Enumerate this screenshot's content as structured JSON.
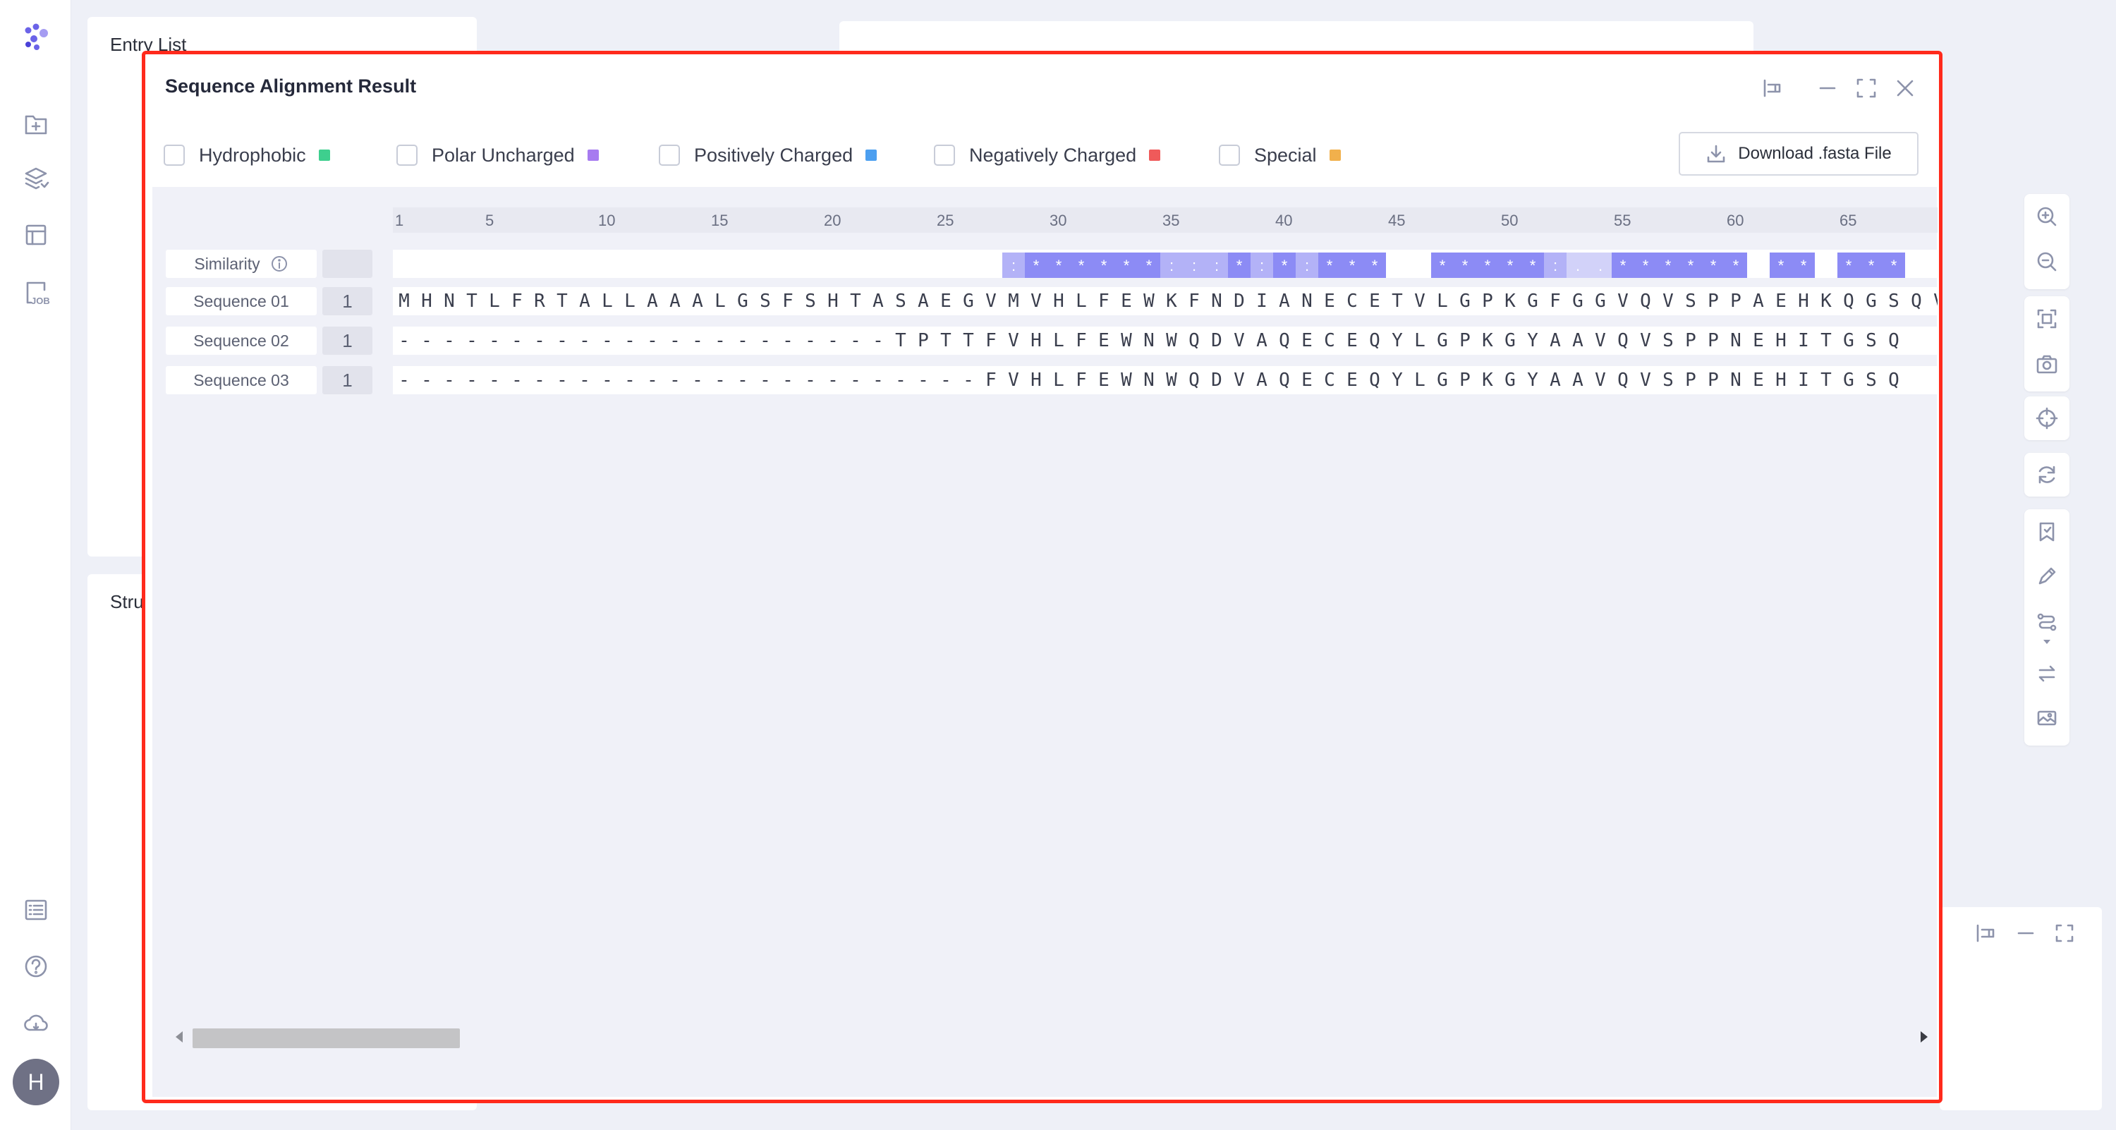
{
  "background": {
    "entry_list_title": "Entry List",
    "structure_title": "Stru"
  },
  "sidebar": {
    "logo": "app-logo",
    "items": [
      "add-file-icon",
      "layers-icon",
      "table-icon",
      "job-icon"
    ],
    "bottom_items": [
      "list-icon",
      "help-icon",
      "cloud-icon"
    ],
    "job_icon_text": "JOB",
    "avatar_letter": "H"
  },
  "modal": {
    "title": "Sequence Alignment Result",
    "legend": [
      {
        "label": "Hydrophobic",
        "color": "#3ecf8e"
      },
      {
        "label": "Polar Uncharged",
        "color": "#a77bf0"
      },
      {
        "label": "Positively Charged",
        "color": "#4c9ff0"
      },
      {
        "label": "Negatively Charged",
        "color": "#ef5a5a"
      },
      {
        "label": "Special",
        "color": "#f1b04c"
      }
    ],
    "download_label": "Download .fasta File",
    "similarity_label": "Similarity",
    "ruler_ticks": [
      "1",
      "5",
      "10",
      "15",
      "20",
      "25",
      "30",
      "35",
      "40",
      "45",
      "50",
      "55",
      "60",
      "65"
    ],
    "sequences": [
      {
        "name": "Sequence 01",
        "start": "1",
        "residues": "MHNTLFRTALLAAALGSFSHTASAEGVMVHLFEWKFNDIANECETVLGPKGFGGVQVSPPAEHKQGSQV"
      },
      {
        "name": "Sequence 02",
        "start": "1",
        "residues": "----------------------TPTTFVHLFEWNWQDVAQECEQYLGPKGYAAVQVSPPNEHITGSQ"
      },
      {
        "name": "Sequence 03",
        "start": "1",
        "residues": "--------------------------FVHLFEWNWQDVAQECEQYLGPKGYAAVQVSPPNEHITGSQ"
      }
    ],
    "similarity": [
      {
        "pos": 27,
        "sym": ":",
        "level": "mid"
      },
      {
        "pos": 28,
        "sym": "*",
        "level": "full"
      },
      {
        "pos": 29,
        "sym": "*",
        "level": "full"
      },
      {
        "pos": 30,
        "sym": "*",
        "level": "full"
      },
      {
        "pos": 31,
        "sym": "*",
        "level": "full"
      },
      {
        "pos": 32,
        "sym": "*",
        "level": "full"
      },
      {
        "pos": 33,
        "sym": "*",
        "level": "full"
      },
      {
        "pos": 34,
        "sym": ":",
        "level": "mid"
      },
      {
        "pos": 35,
        "sym": ":",
        "level": "mid"
      },
      {
        "pos": 36,
        "sym": ":",
        "level": "mid"
      },
      {
        "pos": 37,
        "sym": "*",
        "level": "full"
      },
      {
        "pos": 38,
        "sym": ":",
        "level": "mid"
      },
      {
        "pos": 39,
        "sym": "*",
        "level": "full"
      },
      {
        "pos": 40,
        "sym": ":",
        "level": "mid"
      },
      {
        "pos": 41,
        "sym": "*",
        "level": "full"
      },
      {
        "pos": 42,
        "sym": "*",
        "level": "full"
      },
      {
        "pos": 43,
        "sym": "*",
        "level": "full"
      },
      {
        "pos": 46,
        "sym": "*",
        "level": "full"
      },
      {
        "pos": 47,
        "sym": "*",
        "level": "full"
      },
      {
        "pos": 48,
        "sym": "*",
        "level": "full"
      },
      {
        "pos": 49,
        "sym": "*",
        "level": "full"
      },
      {
        "pos": 50,
        "sym": "*",
        "level": "full"
      },
      {
        "pos": 51,
        "sym": ":",
        "level": "mid"
      },
      {
        "pos": 52,
        "sym": ".",
        "level": "low"
      },
      {
        "pos": 53,
        "sym": ".",
        "level": "low"
      },
      {
        "pos": 54,
        "sym": "*",
        "level": "full"
      },
      {
        "pos": 55,
        "sym": "*",
        "level": "full"
      },
      {
        "pos": 56,
        "sym": "*",
        "level": "full"
      },
      {
        "pos": 57,
        "sym": "*",
        "level": "full"
      },
      {
        "pos": 58,
        "sym": "*",
        "level": "full"
      },
      {
        "pos": 59,
        "sym": "*",
        "level": "full"
      },
      {
        "pos": 61,
        "sym": "*",
        "level": "full"
      },
      {
        "pos": 62,
        "sym": "*",
        "level": "full"
      },
      {
        "pos": 64,
        "sym": "*",
        "level": "full"
      },
      {
        "pos": 65,
        "sym": "*",
        "level": "full"
      },
      {
        "pos": 66,
        "sym": "*",
        "level": "full"
      }
    ],
    "similarity_colors": {
      "full": "#8c8bf5",
      "mid": "#b3b2f7",
      "low": "#d2d2f9"
    },
    "scroll_fraction": 0.14
  },
  "right_rail": [
    "zoom-in-icon",
    "zoom-out-icon",
    "fit-view-icon",
    "camera-icon",
    "target-icon",
    "refresh-icon",
    "bookmark-icon",
    "pencil-icon",
    "route-icon",
    "swap-icon",
    "image-icon"
  ]
}
